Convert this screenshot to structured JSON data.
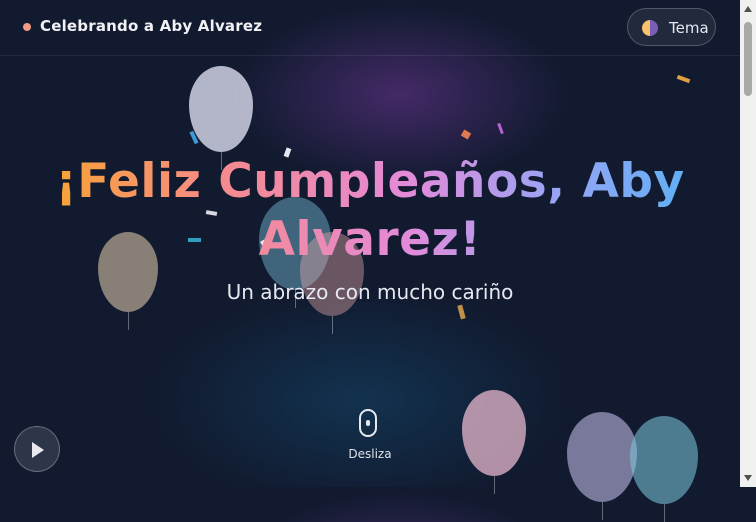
{
  "header": {
    "title": "Celebrando a Aby Alvarez",
    "theme_button_label": "Tema",
    "theme_icon": "half-moon-icon"
  },
  "hero": {
    "title": "¡Feliz Cumpleaños, Aby Alvarez!",
    "subtitle": "Un abrazo con mucho cariño"
  },
  "scroll_hint": {
    "label": "Desliza",
    "icon": "mouse-scroll-icon"
  },
  "music": {
    "icon": "play-icon"
  },
  "colors": {
    "background": "#111a2f",
    "brand_dot": "#f29a83",
    "title_gradient": [
      "#f9a530",
      "#f58a8e",
      "#e48ad8",
      "#9aa4f5",
      "#5ab1f4"
    ]
  }
}
